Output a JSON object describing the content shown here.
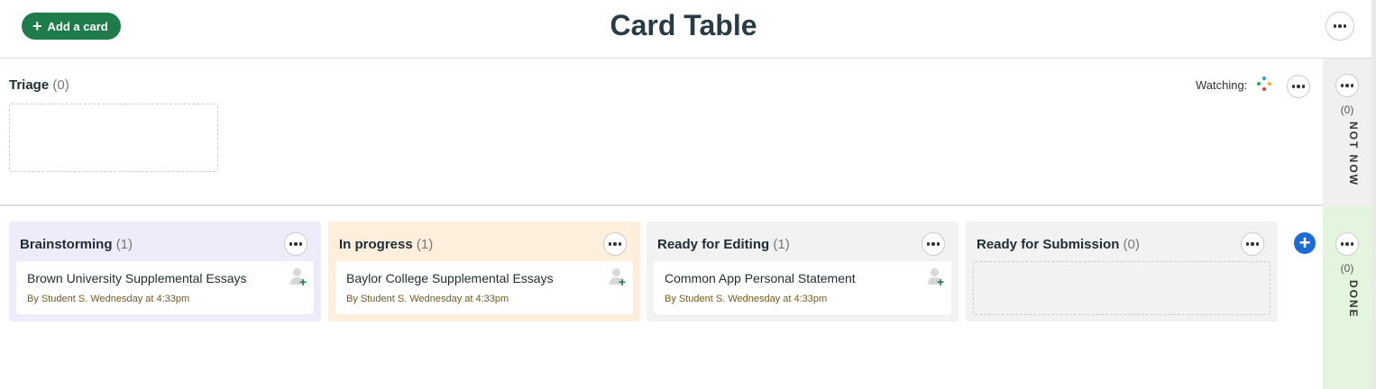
{
  "header": {
    "add_card_label": "Add a card",
    "title": "Card Table"
  },
  "triage": {
    "title": "Triage",
    "count": "(0)",
    "watching_label": "Watching:"
  },
  "side_panels": {
    "not_now": {
      "count": "(0)",
      "label": "NOT NOW"
    },
    "done": {
      "count": "(0)",
      "label": "DONE"
    }
  },
  "columns": [
    {
      "title": "Brainstorming",
      "count": "(1)",
      "color": "#efebfb",
      "cards": [
        {
          "title": "Brown University Supplemental Essays",
          "meta": "By Student S. Wednesday at 4:33pm"
        }
      ]
    },
    {
      "title": "In progress",
      "count": "(1)",
      "color": "#fdefdc",
      "cards": [
        {
          "title": "Baylor College Supplemental Essays",
          "meta": "By Student S. Wednesday at 4:33pm"
        }
      ]
    },
    {
      "title": "Ready for Editing",
      "count": "(1)",
      "color": "#f2f2f2",
      "cards": [
        {
          "title": "Common App Personal Statement",
          "meta": "By Student S. Wednesday at 4:33pm"
        }
      ]
    },
    {
      "title": "Ready for Submission",
      "count": "(0)",
      "color": "#f2f2f2",
      "cards": []
    }
  ],
  "colors": {
    "accent_green": "#1e7c4a",
    "add_column_blue": "#1b6ad8"
  },
  "icons": {
    "add": "plus-icon",
    "menu": "ellipsis-icon",
    "watchers": "watchers-icon",
    "assign": "add-person-icon"
  }
}
